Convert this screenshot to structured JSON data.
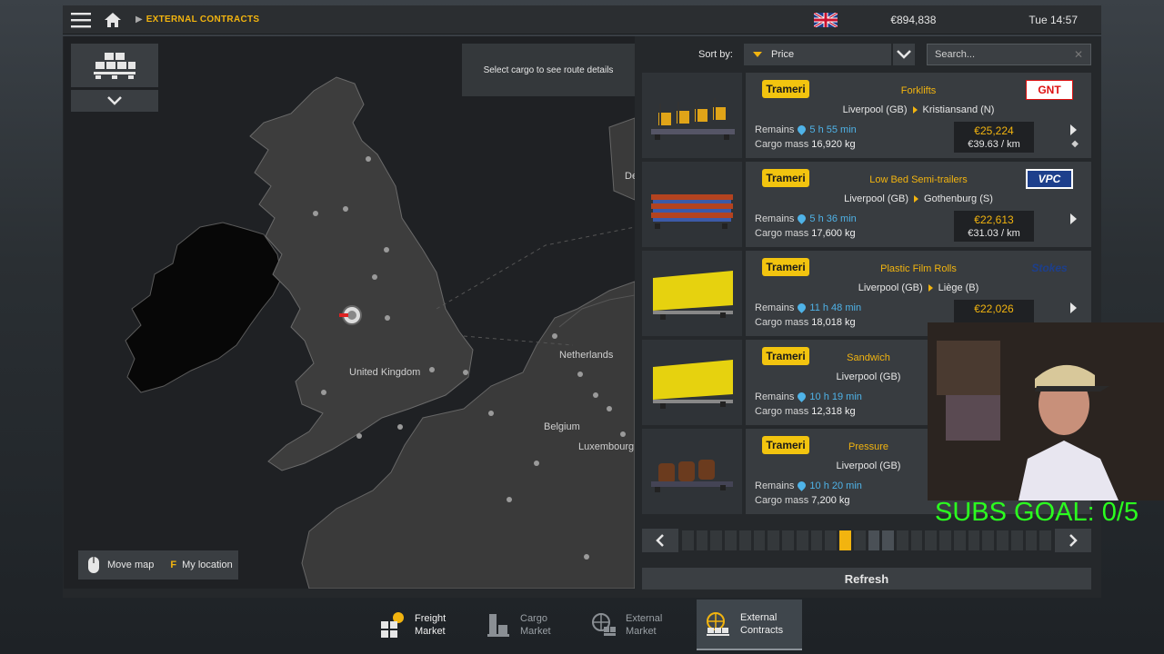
{
  "topbar": {
    "breadcrumb": "EXTERNAL CONTRACTS",
    "money": "€894,838",
    "time": "Tue 14:57"
  },
  "map": {
    "route_hint": "Select cargo to see route details",
    "labels": {
      "uk": "United Kingdom",
      "netherlands": "Netherlands",
      "belgium": "Belgium",
      "luxembourg": "Luxembourg",
      "de": "De"
    },
    "legend": {
      "move_label": "Move map",
      "key": "F",
      "location_label": "My location"
    }
  },
  "sort": {
    "label": "Sort by:",
    "value": "Price"
  },
  "search": {
    "placeholder": "Search..."
  },
  "cargo_list": [
    {
      "company": "Trameri",
      "cargo": "Forklifts",
      "brand": "GNT",
      "origin": "Liverpool (GB)",
      "destination": "Kristiansand (N)",
      "remains_label": "Remains",
      "remains": "5 h 55 min",
      "mass_label": "Cargo mass",
      "mass": "16,920 kg",
      "price": "€25,224",
      "per_km": "€39.63 / km"
    },
    {
      "company": "Trameri",
      "cargo": "Low Bed Semi-trailers",
      "brand": "VPC",
      "origin": "Liverpool (GB)",
      "destination": "Gothenburg (S)",
      "remains_label": "Remains",
      "remains": "5 h 36 min",
      "mass_label": "Cargo mass",
      "mass": "17,600 kg",
      "price": "€22,613",
      "per_km": "€31.03 / km"
    },
    {
      "company": "Trameri",
      "cargo": "Plastic Film Rolls",
      "brand": "Stokes",
      "origin": "Liverpool (GB)",
      "destination": "Liège (B)",
      "remains_label": "Remains",
      "remains": "11 h 48 min",
      "mass_label": "Cargo mass",
      "mass": "18,018 kg",
      "price": "€22,026",
      "per_km": ""
    },
    {
      "company": "Trameri",
      "cargo": "Sandwich",
      "brand": "",
      "origin": "Liverpool (GB)",
      "destination": "",
      "remains_label": "Remains",
      "remains": "10 h 19 min",
      "mass_label": "Cargo mass",
      "mass": "12,318 kg",
      "price": "",
      "per_km": ""
    },
    {
      "company": "Trameri",
      "cargo": "Pressure",
      "brand": "",
      "origin": "Liverpool (GB)",
      "destination": "",
      "remains_label": "Remains",
      "remains": "10 h 20 min",
      "mass_label": "Cargo mass",
      "mass": "7,200 kg",
      "price": "",
      "per_km": ""
    }
  ],
  "pager": {
    "pages": 26,
    "active_index": 11
  },
  "refresh_label": "Refresh",
  "tabs": [
    {
      "line1": "Freight",
      "line2": "Market",
      "icon": "freight-market-icon"
    },
    {
      "line1": "Cargo",
      "line2": "Market",
      "icon": "cargo-market-icon"
    },
    {
      "line1": "External",
      "line2": "Market",
      "icon": "external-market-icon"
    },
    {
      "line1": "External",
      "line2": "Contracts",
      "icon": "external-contracts-icon"
    }
  ],
  "overlay": {
    "subs_goal": "SUBS GOAL: 0/5"
  },
  "colors": {
    "accent": "#f2b40f",
    "time_blue": "#4fb3e8",
    "subs_green": "#2bff1f"
  }
}
